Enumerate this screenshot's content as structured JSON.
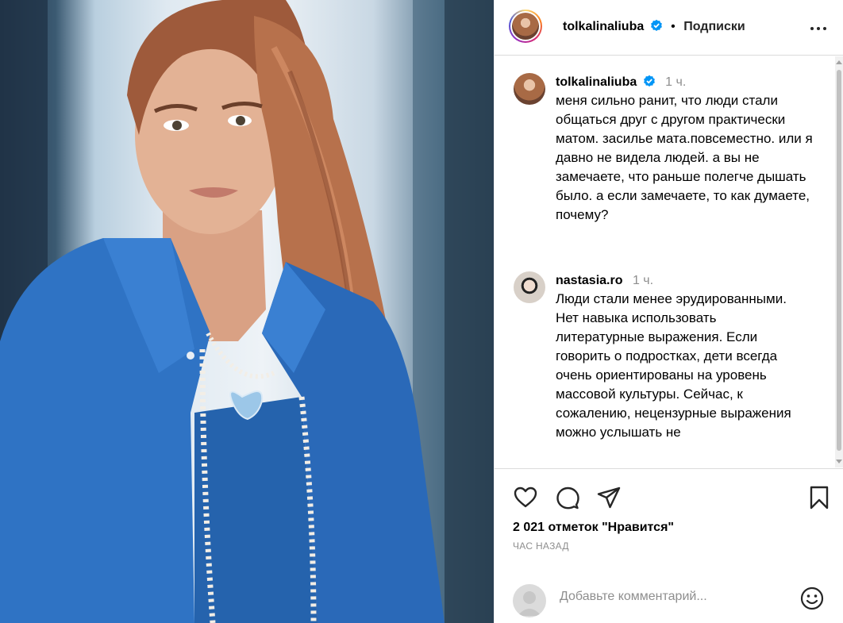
{
  "photo": {
    "alt": ""
  },
  "header": {
    "username": "tolkalinaliuba",
    "separator": "•",
    "follow_label": "Подписки"
  },
  "caption": {
    "username": "tolkalinaliuba",
    "time": "1 ч.",
    "text": "меня сильно ранит, что люди стали общаться друг с другом практически матом. засилье мата.повсеместно. или я давно не видела людей. а вы не замечаете, что раньше полегче дышать было. а если замечаете, то как думаете, почему?"
  },
  "comment": {
    "username": "nastasia.ro",
    "time": "1 ч.",
    "text": "Люди стали менее эрудированными. Нет навыка использовать литературные выражения. Если говорить о подростках, дети всегда очень ориентированы на уровень массовой культуры. Сейчас, к сожалению, нецензурные выражения можно услышать не"
  },
  "actions": {
    "likes": "2 021 отметок \"Нравится\"",
    "posted_ago": "ЧАС НАЗАД"
  },
  "add_comment": {
    "placeholder": "Добавьте комментарий..."
  },
  "colors": {
    "accent_verified": "#0095f6",
    "secondary_text": "#8e8e8e",
    "border": "#dbdbdb"
  },
  "icons": {
    "verified": "verified-badge-icon",
    "more": "more-options-icon",
    "like": "heart-icon",
    "comment": "comment-bubble-icon",
    "share": "paper-plane-icon",
    "save": "bookmark-icon",
    "emoji": "emoji-smile-icon"
  }
}
